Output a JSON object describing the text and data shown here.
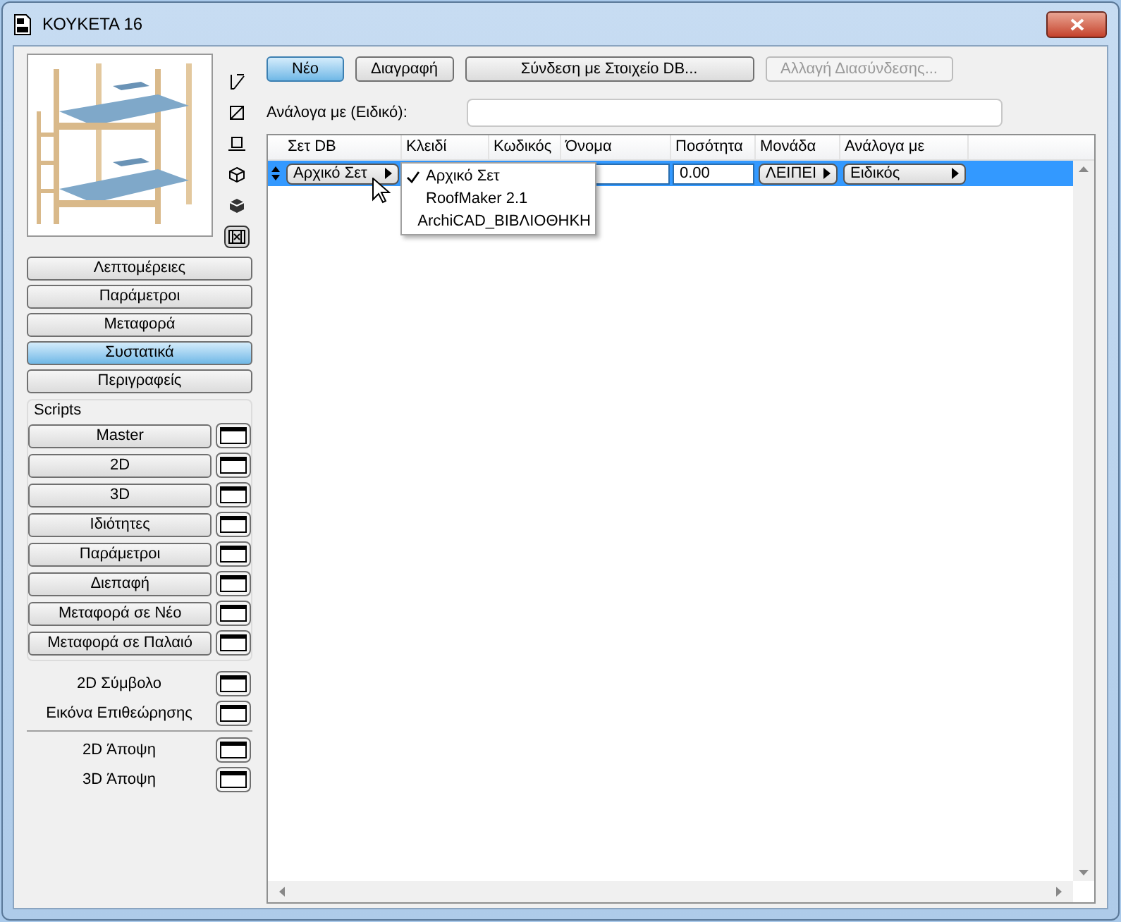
{
  "window": {
    "title": "ΚΟΥΚΕΤΑ 16"
  },
  "view_icons": [
    {
      "kind": "plan",
      "selected": false
    },
    {
      "kind": "section",
      "selected": false
    },
    {
      "kind": "elevation",
      "selected": false
    },
    {
      "kind": "wire",
      "selected": false
    },
    {
      "kind": "solid",
      "selected": false
    },
    {
      "kind": "film",
      "selected": true
    }
  ],
  "nav": [
    {
      "label": "Λεπτομέρειες",
      "selected": false
    },
    {
      "label": "Παράμετροι",
      "selected": false
    },
    {
      "label": "Μεταφορά",
      "selected": false
    },
    {
      "label": "Συστατικά",
      "selected": true
    },
    {
      "label": "Περιγραφείς",
      "selected": false
    }
  ],
  "scripts": {
    "label": "Scripts",
    "items": [
      "Master",
      "2D",
      "3D",
      "Ιδιότητες",
      "Παράμετροι",
      "Διεπαφή",
      "Μεταφορά σε Νέο",
      "Μεταφορά σε Παλαιό"
    ]
  },
  "views": [
    [
      "2D Σύμβολο",
      "Εικόνα Επιθεώρησης"
    ],
    [
      "2D Άποψη",
      "3D Άποψη"
    ]
  ],
  "toolbar": [
    {
      "label": "Νέο",
      "default": true,
      "disabled": false
    },
    {
      "label": "Διαγραφή",
      "default": false,
      "disabled": false
    },
    {
      "label": "Σύνδεση με Στοιχείο DB...",
      "default": false,
      "disabled": false
    },
    {
      "label": "Αλλαγή Διασύνδεσης...",
      "default": false,
      "disabled": true
    }
  ],
  "filter": {
    "label": "Ανάλογα με (Ειδικό):"
  },
  "table": {
    "columns": [
      "Σετ DB",
      "Κλειδί",
      "Κωδικός",
      "Όνομα",
      "Ποσότητα",
      "Μονάδα",
      "Ανάλογα με"
    ],
    "rows": [
      {
        "selected": true,
        "cells": [
          {
            "kind": "popup",
            "text": "Αρχικό Σετ"
          },
          {
            "kind": "empty"
          },
          {
            "kind": "empty"
          },
          {
            "kind": "field"
          },
          {
            "kind": "field",
            "text": "0.00"
          },
          {
            "kind": "popup",
            "text": "ΛΕΙΠΕΙ"
          },
          {
            "kind": "popup",
            "text": "Ειδικός"
          }
        ]
      }
    ]
  },
  "menu": [
    {
      "label": "Αρχικό Σετ",
      "checked": true
    },
    {
      "label": "RoofMaker 2.1",
      "checked": false
    },
    {
      "label": "ArchiCAD_ΒΙΒΛΙΟΘΗΚΗ",
      "checked": false
    }
  ]
}
